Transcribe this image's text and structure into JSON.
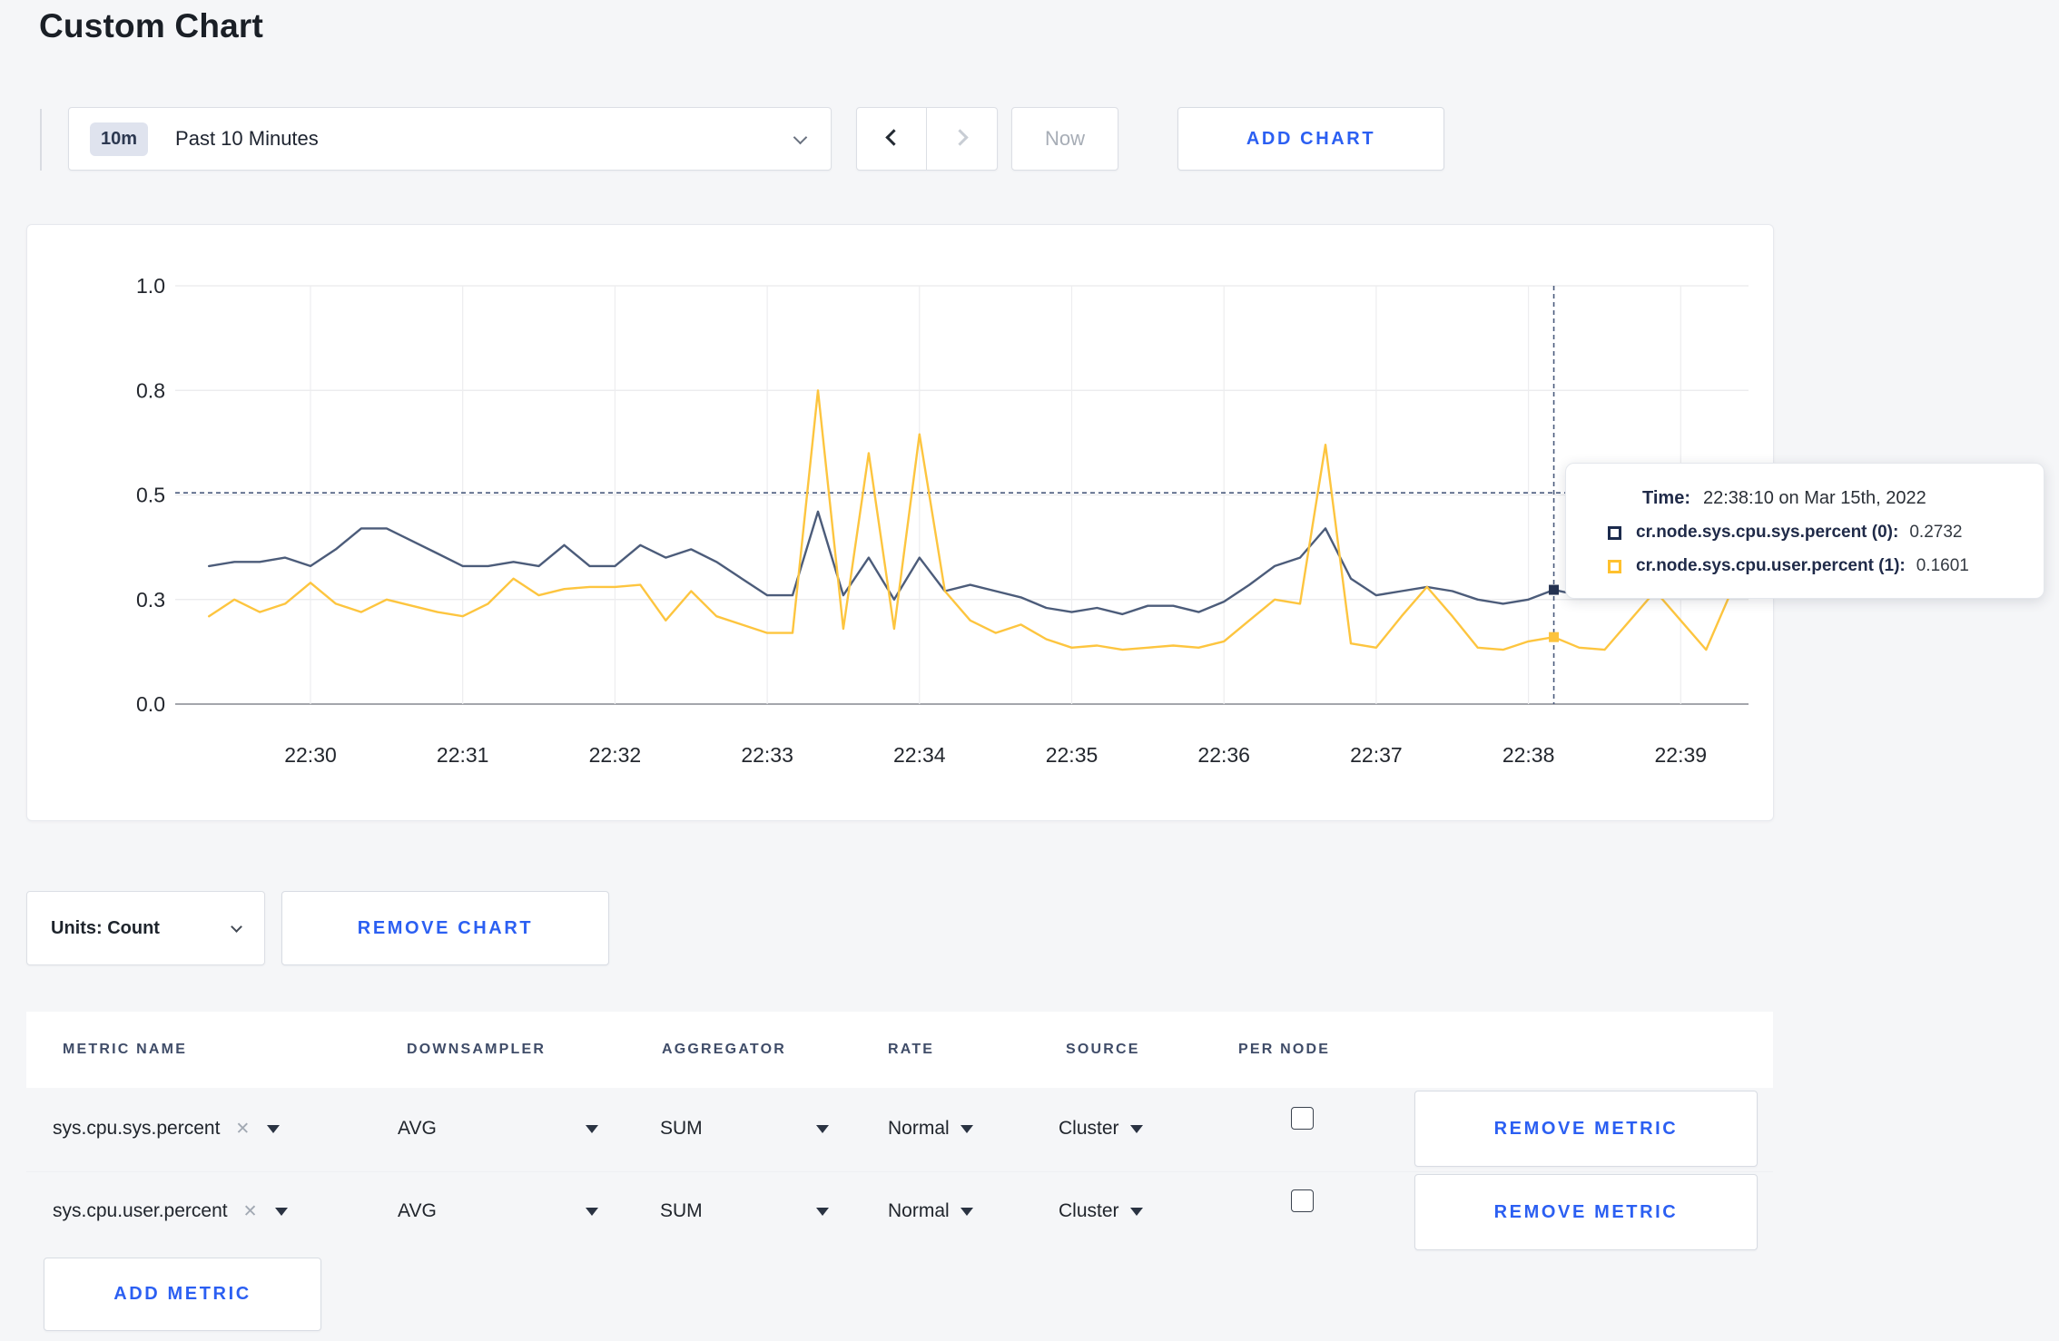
{
  "page": {
    "title": "Custom Chart",
    "background": "#f5f6f8",
    "accent_blue": "#2b5ff2"
  },
  "icons": {
    "timescale_dropdown": "chevron-down-icon",
    "prev": "chevron-left-icon",
    "next": "chevron-right-icon",
    "units_dropdown": "chevron-down-icon",
    "metric_clear": "x-icon",
    "select_caret": "triangle-down-icon"
  },
  "toolbar": {
    "timescale": {
      "badge": "10m",
      "label": "Past 10 Minutes"
    },
    "now_label": "Now",
    "add_chart_label": "ADD CHART"
  },
  "chart_data": {
    "type": "line",
    "title": "",
    "xlabel": "",
    "ylabel": "",
    "grid": true,
    "legend_position": "none",
    "ylim": [
      0,
      1.0
    ],
    "y_axis": {
      "ticks": [
        {
          "value": 0,
          "label": "0.0"
        },
        {
          "value": 0.25,
          "label": "0.3"
        },
        {
          "value": 0.5,
          "label": "0.5"
        },
        {
          "value": 0.75,
          "label": "0.8"
        },
        {
          "value": 1,
          "label": "1.0"
        }
      ]
    },
    "x_axis": {
      "start_time": "22:29:20",
      "step_seconds": 10,
      "ticks": [
        {
          "t": 40,
          "label": "22:30"
        },
        {
          "t": 100,
          "label": "22:31"
        },
        {
          "t": 160,
          "label": "22:32"
        },
        {
          "t": 220,
          "label": "22:33"
        },
        {
          "t": 280,
          "label": "22:34"
        },
        {
          "t": 340,
          "label": "22:35"
        },
        {
          "t": 400,
          "label": "22:36"
        },
        {
          "t": 460,
          "label": "22:37"
        },
        {
          "t": 520,
          "label": "22:38"
        },
        {
          "t": 580,
          "label": "22:39"
        }
      ]
    },
    "series": [
      {
        "name": "cr.node.sys.cpu.sys.percent (0)",
        "color": "#4c5c7a",
        "marker_color": "#253352",
        "values": [
          0.33,
          0.34,
          0.34,
          0.35,
          0.33,
          0.37,
          0.42,
          0.42,
          0.39,
          0.36,
          0.33,
          0.33,
          0.34,
          0.33,
          0.38,
          0.33,
          0.33,
          0.38,
          0.35,
          0.37,
          0.34,
          0.3,
          0.26,
          0.26,
          0.46,
          0.26,
          0.35,
          0.25,
          0.35,
          0.27,
          0.285,
          0.27,
          0.255,
          0.23,
          0.22,
          0.23,
          0.215,
          0.235,
          0.235,
          0.22,
          0.245,
          0.285,
          0.33,
          0.35,
          0.42,
          0.3,
          0.26,
          0.27,
          0.28,
          0.27,
          0.25,
          0.24,
          0.25,
          0.2732,
          0.26,
          0.27,
          0.26,
          0.27,
          0.28,
          0.27,
          0.28
        ]
      },
      {
        "name": "cr.node.sys.cpu.user.percent (1)",
        "color": "#fdc53f",
        "marker_color": "#fdc33c",
        "values": [
          0.21,
          0.25,
          0.22,
          0.24,
          0.29,
          0.24,
          0.22,
          0.25,
          0.235,
          0.22,
          0.21,
          0.24,
          0.3,
          0.26,
          0.275,
          0.28,
          0.28,
          0.285,
          0.2,
          0.27,
          0.21,
          0.19,
          0.17,
          0.17,
          0.75,
          0.18,
          0.6,
          0.18,
          0.645,
          0.27,
          0.2,
          0.17,
          0.19,
          0.155,
          0.135,
          0.14,
          0.13,
          0.135,
          0.14,
          0.135,
          0.15,
          0.2,
          0.25,
          0.24,
          0.62,
          0.145,
          0.135,
          0.21,
          0.28,
          0.21,
          0.135,
          0.13,
          0.15,
          0.1601,
          0.135,
          0.13,
          0.2,
          0.27,
          0.2,
          0.13,
          0.27
        ]
      }
    ],
    "crosshair": {
      "index": 53,
      "t": 530,
      "time": "22:38:10",
      "mouse_y_value": 0.505
    }
  },
  "tooltip": {
    "time_label": "Time:",
    "time_value": "22:38:10 on Mar 15th, 2022",
    "rows": [
      {
        "label": "cr.node.sys.cpu.sys.percent (0):",
        "value": "0.2732",
        "color": "#1c2b4d"
      },
      {
        "label": "cr.node.sys.cpu.user.percent (1):",
        "value": "0.1601",
        "color": "#ffc12e"
      }
    ]
  },
  "chart_controls": {
    "units_label": "Units: Count",
    "remove_chart_label": "REMOVE CHART"
  },
  "metrics_table": {
    "headers": [
      "METRIC NAME",
      "DOWNSAMPLER",
      "AGGREGATOR",
      "RATE",
      "SOURCE",
      "PER NODE"
    ],
    "rows": [
      {
        "metric": "sys.cpu.sys.percent",
        "downsampler": "AVG",
        "aggregator": "SUM",
        "rate": "Normal",
        "source": "Cluster",
        "per_node_checked": false,
        "remove_label": "REMOVE METRIC"
      },
      {
        "metric": "sys.cpu.user.percent",
        "downsampler": "AVG",
        "aggregator": "SUM",
        "rate": "Normal",
        "source": "Cluster",
        "per_node_checked": false,
        "remove_label": "REMOVE METRIC"
      }
    ],
    "add_metric_label": "ADD METRIC"
  }
}
